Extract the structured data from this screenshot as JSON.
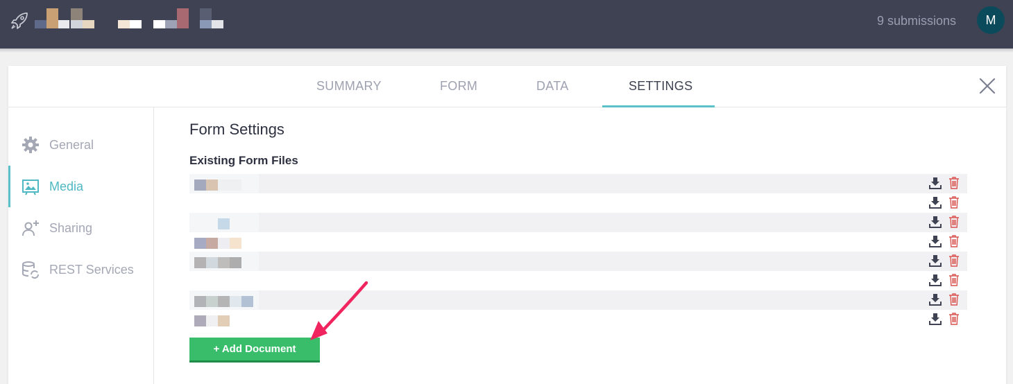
{
  "header": {
    "submissions_text": "9 submissions",
    "avatar_initial": "M"
  },
  "tabs": [
    {
      "label": "SUMMARY"
    },
    {
      "label": "FORM"
    },
    {
      "label": "DATA"
    },
    {
      "label": "SETTINGS",
      "active": true
    }
  ],
  "sidebar": {
    "items": [
      {
        "label": "General",
        "icon": "gear-icon"
      },
      {
        "label": "Media",
        "icon": "media-icon",
        "active": true
      },
      {
        "label": "Sharing",
        "icon": "add-user-icon"
      },
      {
        "label": "REST Services",
        "icon": "database-sync-icon"
      }
    ]
  },
  "main": {
    "title": "Form Settings",
    "files_heading": "Existing Form Files",
    "add_button_label": "+ Add Document"
  },
  "colors": {
    "topbar": "#3f4253",
    "accent": "#5bc1c8",
    "add_button": "#39bd6b",
    "delete_icon": "#d9534f",
    "download_icon": "#3f4253",
    "annotation_arrow": "#f0245e"
  }
}
